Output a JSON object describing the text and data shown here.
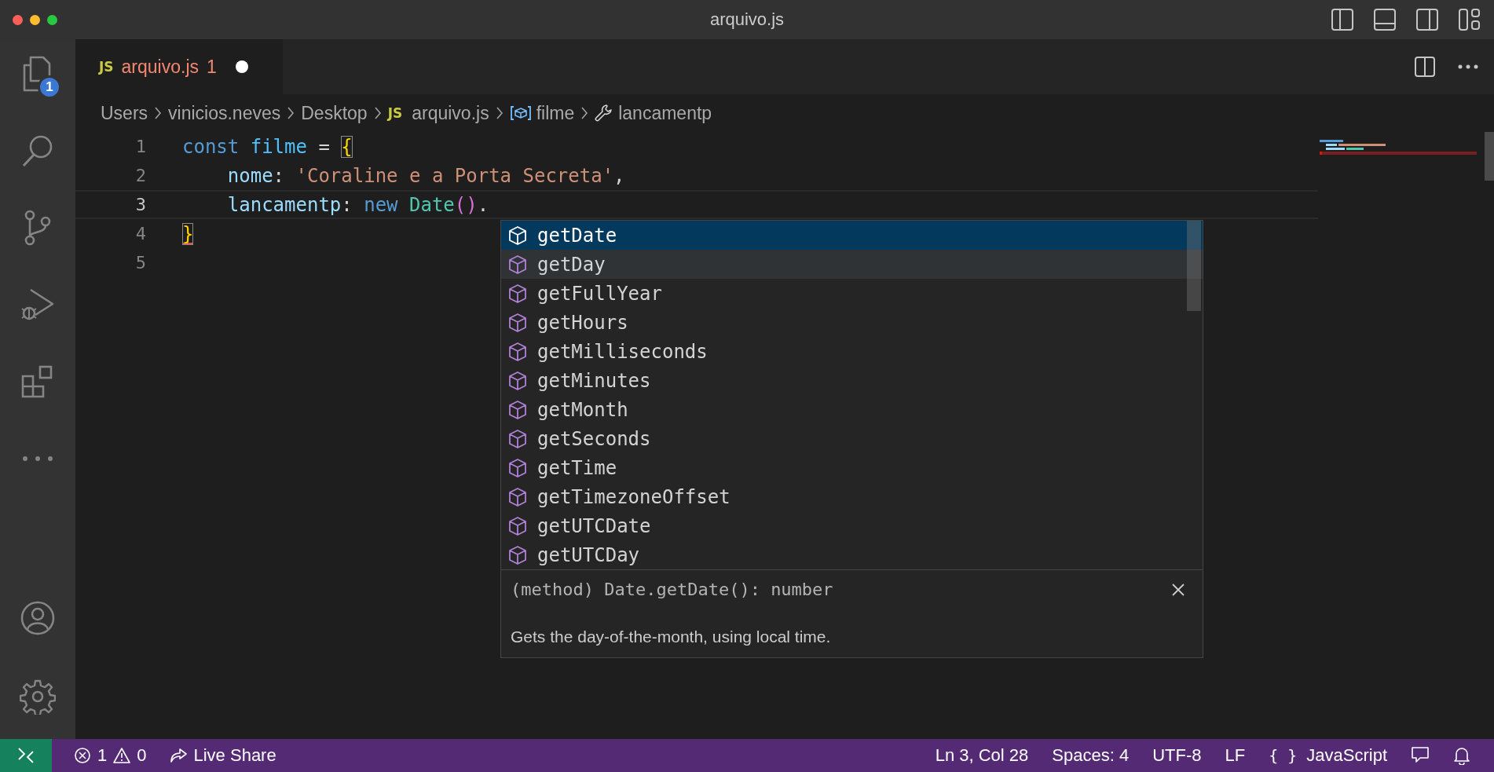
{
  "window": {
    "title": "arquivo.js"
  },
  "activity_bar": {
    "top": [
      {
        "kind": "explorer",
        "badge": "1"
      },
      {
        "kind": "search"
      },
      {
        "kind": "source-control"
      },
      {
        "kind": "run-debug"
      },
      {
        "kind": "extensions"
      },
      {
        "kind": "more"
      }
    ],
    "bottom": [
      {
        "kind": "accounts"
      },
      {
        "kind": "settings"
      }
    ]
  },
  "tab": {
    "file_icon": "JS",
    "label": "arquivo.js",
    "problems": "1",
    "dirty": true
  },
  "breadcrumbs": [
    {
      "kind": "folder",
      "label": "Users"
    },
    {
      "kind": "folder",
      "label": "vinicios.neves"
    },
    {
      "kind": "folder",
      "label": "Desktop"
    },
    {
      "kind": "file",
      "icon": "JS",
      "label": "arquivo.js"
    },
    {
      "kind": "variable",
      "label": "filme"
    },
    {
      "kind": "property",
      "label": "lancamentp"
    }
  ],
  "editor": {
    "lines": [
      {
        "number": "1",
        "current": false,
        "tokens": [
          {
            "text": "const ",
            "kind": "keyword",
            "matched": false,
            "error": false
          },
          {
            "text": "filme",
            "kind": "variable",
            "matched": false,
            "error": false
          },
          {
            "text": " = ",
            "kind": "punct",
            "matched": false,
            "error": false
          },
          {
            "text": "{",
            "kind": "bracket",
            "matched": true,
            "error": false
          }
        ]
      },
      {
        "number": "2",
        "current": false,
        "tokens": [
          {
            "text": "    nome",
            "kind": "property",
            "matched": false,
            "error": false
          },
          {
            "text": ": ",
            "kind": "punct",
            "matched": false,
            "error": false
          },
          {
            "text": "'Coraline e a Porta Secreta'",
            "kind": "string",
            "matched": false,
            "error": false
          },
          {
            "text": ",",
            "kind": "punct",
            "matched": false,
            "error": false
          }
        ]
      },
      {
        "number": "3",
        "current": true,
        "tokens": [
          {
            "text": "    lancamentp",
            "kind": "property",
            "matched": false,
            "error": false
          },
          {
            "text": ": ",
            "kind": "punct",
            "matched": false,
            "error": false
          },
          {
            "text": "new ",
            "kind": "keyword",
            "matched": false,
            "error": false
          },
          {
            "text": "Date",
            "kind": "class",
            "matched": false,
            "error": false
          },
          {
            "text": "()",
            "kind": "paren",
            "matched": false,
            "error": false
          },
          {
            "text": ".",
            "kind": "punct",
            "matched": false,
            "error": false
          }
        ]
      },
      {
        "number": "4",
        "current": false,
        "tokens": [
          {
            "text": "}",
            "kind": "bracket",
            "matched": true,
            "error": true
          }
        ]
      },
      {
        "number": "5",
        "current": false
      }
    ]
  },
  "suggest": {
    "items": [
      {
        "label": "getDate",
        "selected": true,
        "hovered": false
      },
      {
        "label": "getDay",
        "selected": false,
        "hovered": true
      },
      {
        "label": "getFullYear",
        "selected": false,
        "hovered": false
      },
      {
        "label": "getHours",
        "selected": false,
        "hovered": false
      },
      {
        "label": "getMilliseconds",
        "selected": false,
        "hovered": false
      },
      {
        "label": "getMinutes",
        "selected": false,
        "hovered": false
      },
      {
        "label": "getMonth",
        "selected": false,
        "hovered": false
      },
      {
        "label": "getSeconds",
        "selected": false,
        "hovered": false
      },
      {
        "label": "getTime",
        "selected": false,
        "hovered": false
      },
      {
        "label": "getTimezoneOffset",
        "selected": false,
        "hovered": false
      },
      {
        "label": "getUTCDate",
        "selected": false,
        "hovered": false
      },
      {
        "label": "getUTCDay",
        "selected": false,
        "hovered": false
      }
    ],
    "detail": "(method) Date.getDate(): number",
    "documentation": "Gets the day-of-the-month, using local time."
  },
  "status_bar": {
    "errors": "1",
    "warnings": "0",
    "live_share": "Live Share",
    "position": "Ln 3, Col 28",
    "indentation": "Spaces: 4",
    "encoding": "UTF-8",
    "eol": "LF",
    "language_icon": "{ }",
    "language": "JavaScript"
  }
}
